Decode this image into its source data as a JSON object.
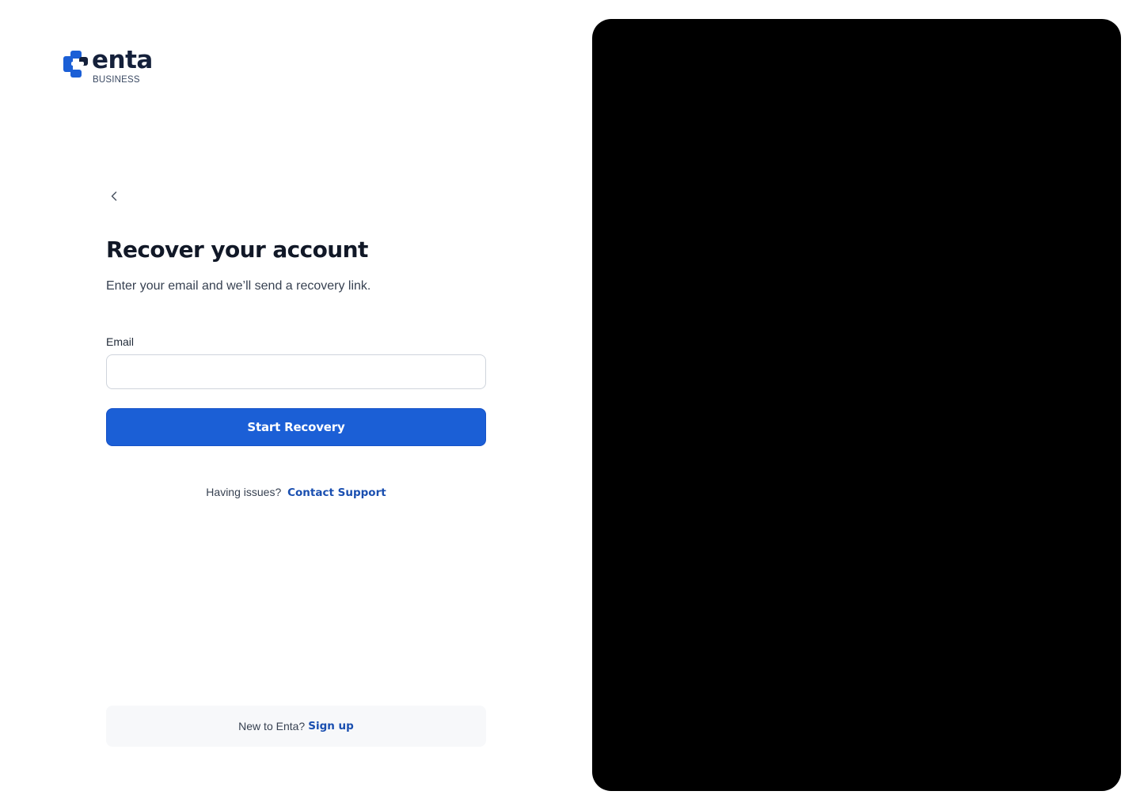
{
  "brand": {
    "wordmark": "enta",
    "sub_label": "BUSINESS",
    "primary_color": "#1b5fd6",
    "text_color": "#14203a"
  },
  "navigation": {
    "back_icon": "chevron-left-icon"
  },
  "form": {
    "title": "Recover your account",
    "subtitle": "Enter your email and we’ll send a recovery link.",
    "email_label": "Email",
    "email_value": "",
    "email_placeholder": "",
    "submit_label": "Start Recovery"
  },
  "support": {
    "prompt": "Having issues?",
    "link_label": "Contact Support"
  },
  "signup": {
    "prompt": "New to Enta?",
    "link_label": "Sign up"
  },
  "side_panel": {
    "background_color": "#000000"
  }
}
